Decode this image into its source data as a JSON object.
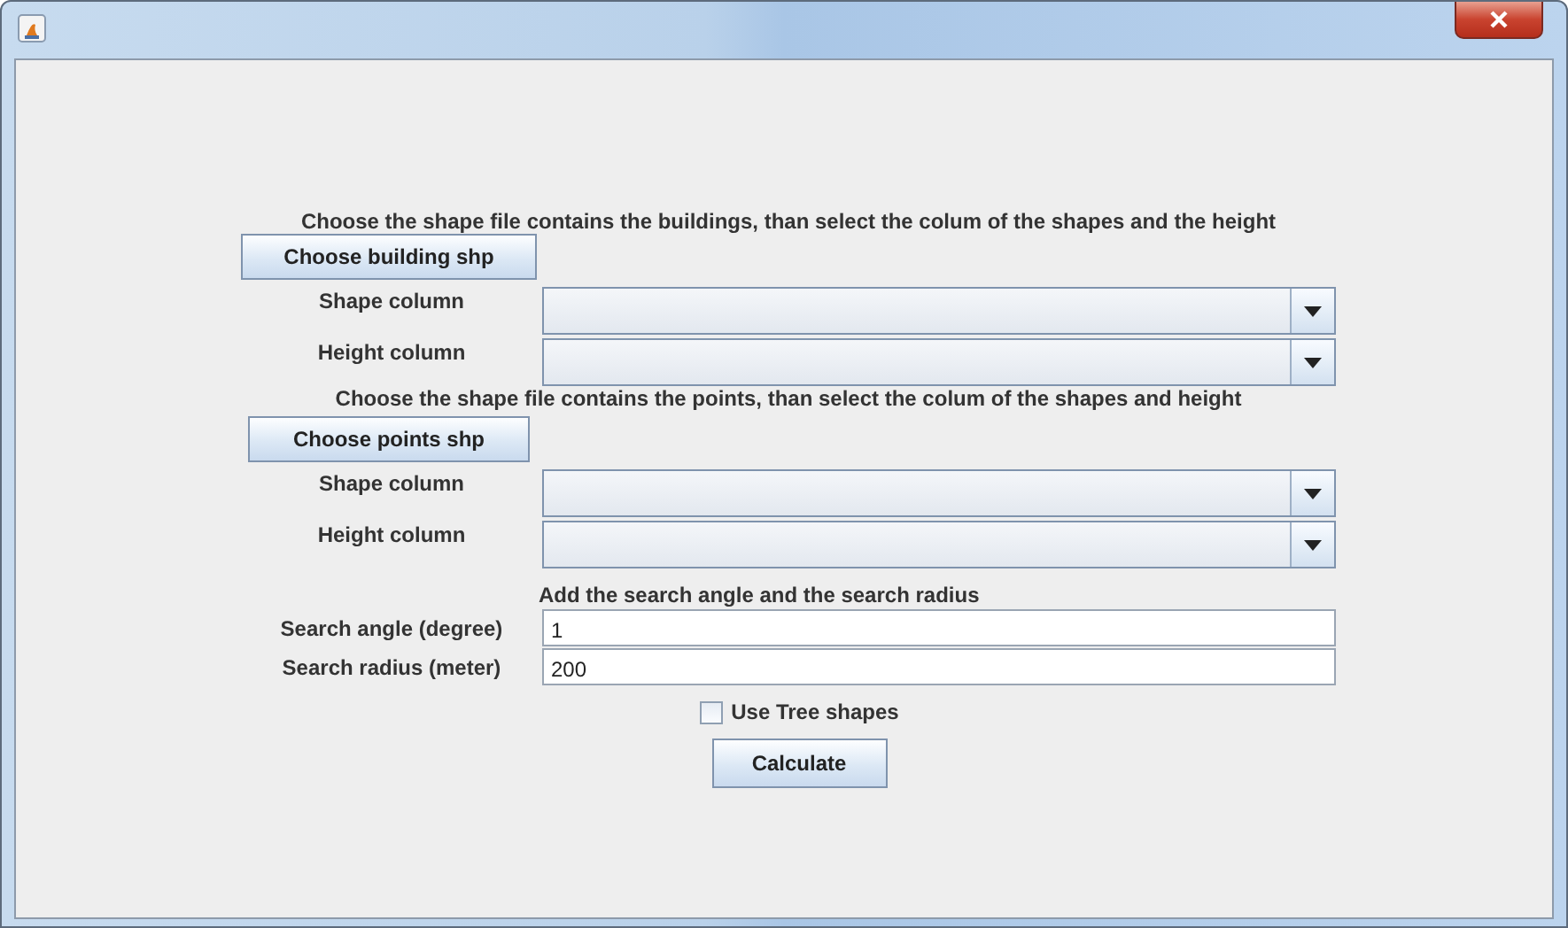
{
  "sections": [
    {
      "instruction": "Choose the shape file contains the buildings, than select the colum of the shapes and the height",
      "button": "Choose building shp",
      "combos": [
        {
          "label": "Shape column"
        },
        {
          "label": "Height column"
        }
      ]
    },
    {
      "instruction": "Choose the shape file contains the points, than select the colum of the shapes and height",
      "button": "Choose points shp",
      "combos": [
        {
          "label": "Shape column"
        },
        {
          "label": "Height column"
        }
      ]
    }
  ],
  "search": {
    "instruction": "Add the search angle and the search radius",
    "fields": [
      {
        "label": "Search angle (degree)",
        "value": "1"
      },
      {
        "label": "Search radius (meter)",
        "value": "200"
      }
    ]
  },
  "checkbox": {
    "label": "Use Tree shapes",
    "checked": false
  },
  "button": "Calculate"
}
